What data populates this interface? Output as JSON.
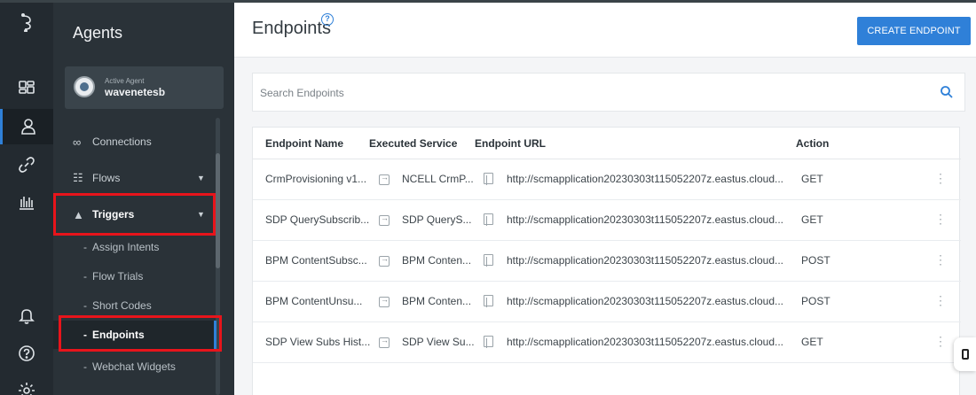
{
  "sidebar": {
    "title": "Agents",
    "agent": {
      "subtitle": "Active Agent",
      "name": "wavenetesb"
    },
    "items": [
      {
        "label": "Connections"
      },
      {
        "label": "Flows"
      },
      {
        "label": "Triggers"
      }
    ],
    "subitems": [
      {
        "label": "Assign Intents"
      },
      {
        "label": "Flow Trials"
      },
      {
        "label": "Short Codes"
      },
      {
        "label": "Endpoints"
      },
      {
        "label": "Webchat Widgets"
      }
    ],
    "dash": "-"
  },
  "header": {
    "title": "Endpoints",
    "create_button": "CREATE ENDPOINT"
  },
  "search": {
    "placeholder": "Search Endpoints"
  },
  "table": {
    "columns": [
      "Endpoint Name",
      "Executed Service",
      "Endpoint URL",
      "Action"
    ],
    "rows": [
      {
        "name": "CrmProvisioning v1...",
        "service": "NCELL CrmP...",
        "url": "http://scmapplication20230303t115052207z.eastus.cloud...",
        "action": "GET"
      },
      {
        "name": "SDP QuerySubscrib...",
        "service": "SDP QueryS...",
        "url": "http://scmapplication20230303t115052207z.eastus.cloud...",
        "action": "GET"
      },
      {
        "name": "BPM ContentSubsc...",
        "service": "BPM Conten...",
        "url": "http://scmapplication20230303t115052207z.eastus.cloud...",
        "action": "POST"
      },
      {
        "name": "BPM ContentUnsu...",
        "service": "BPM Conten...",
        "url": "http://scmapplication20230303t115052207z.eastus.cloud...",
        "action": "POST"
      },
      {
        "name": "SDP View Subs Hist...",
        "service": "SDP View Su...",
        "url": "http://scmapplication20230303t115052207z.eastus.cloud...",
        "action": "GET"
      }
    ]
  },
  "colors": {
    "accent": "#2f80d8",
    "highlight": "#e8141b",
    "rail": "#232a30",
    "sidebar": "#2a3238"
  },
  "icons": [
    "logo-icon",
    "dashboard-icon",
    "user-icon",
    "link-icon",
    "analytics-icon",
    "bell-icon",
    "help-icon",
    "settings-icon",
    "search-icon",
    "copy-icon",
    "kebab-icon"
  ]
}
